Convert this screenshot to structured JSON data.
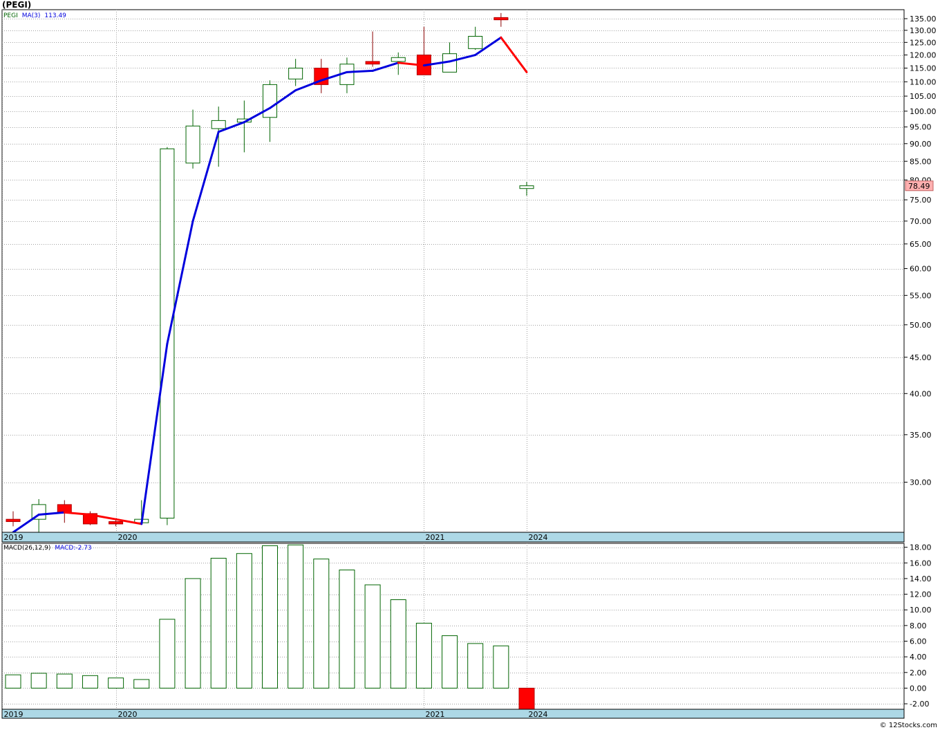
{
  "page": {
    "title": "(PEGI)",
    "credit": "© 12Stocks.com"
  },
  "price_panel": {
    "legend": {
      "symbol": "PEGI",
      "ma_label": "MA(3)",
      "ma_value": "113.49"
    },
    "last_price_label": "78.49",
    "y_ticks": [
      30,
      35,
      40,
      45,
      50,
      55,
      60,
      65,
      70,
      75,
      80,
      85,
      90,
      95,
      100,
      105,
      110,
      115,
      120,
      125,
      130,
      135
    ],
    "x_labels": [
      "2019",
      "2020",
      "2021",
      "2024"
    ]
  },
  "macd_panel": {
    "legend": {
      "label": "MACD(26,12,9)",
      "value_label": "MACD:-2.73"
    },
    "y_ticks": [
      -2,
      0,
      2,
      4,
      6,
      8,
      10,
      12,
      14,
      16,
      18
    ],
    "x_labels": [
      "2019",
      "2020",
      "2021",
      "2024"
    ]
  },
  "colors": {
    "up_candle": "#006400",
    "down_candle": "#ff0000",
    "ma_up": "#0000dd",
    "ma_down": "#ff0000",
    "grid": "#a0a0a0",
    "axis_band": "#add8e6",
    "price_label_bg": "#ffb0b0"
  },
  "chart_data": [
    {
      "type": "candlestick",
      "title": "(PEGI)",
      "scale": "log",
      "ylim": [
        25.5,
        139
      ],
      "x_labels": [
        "2019",
        "2020",
        "2021",
        "2024"
      ],
      "candles": [
        {
          "o": 26.6,
          "h": 27.3,
          "l": 26.0,
          "c": 26.4
        },
        {
          "o": 26.6,
          "h": 28.4,
          "l": 25.5,
          "c": 27.9
        },
        {
          "o": 27.9,
          "h": 28.3,
          "l": 26.3,
          "c": 27.2
        },
        {
          "o": 27.1,
          "h": 27.3,
          "l": 26.1,
          "c": 26.2
        },
        {
          "o": 26.4,
          "h": 26.6,
          "l": 26.0,
          "c": 26.2
        },
        {
          "o": 26.3,
          "h": 28.3,
          "l": 26.2,
          "c": 26.6
        },
        {
          "o": 26.7,
          "h": 89.0,
          "l": 26.1,
          "c": 88.5
        },
        {
          "o": 84.5,
          "h": 100.5,
          "l": 83.0,
          "c": 95.3
        },
        {
          "o": 94.5,
          "h": 101.5,
          "l": 83.5,
          "c": 97.0
        },
        {
          "o": 96.5,
          "h": 103.5,
          "l": 87.5,
          "c": 97.5
        },
        {
          "o": 98.0,
          "h": 110.5,
          "l": 90.5,
          "c": 109.0
        },
        {
          "o": 111.0,
          "h": 118.5,
          "l": 108.5,
          "c": 115.0
        },
        {
          "o": 115.0,
          "h": 118.5,
          "l": 106.0,
          "c": 109.0
        },
        {
          "o": 109.0,
          "h": 119.0,
          "l": 106.0,
          "c": 116.5
        },
        {
          "o": 117.5,
          "h": 129.5,
          "l": 115.5,
          "c": 116.5
        },
        {
          "o": 117.5,
          "h": 121.0,
          "l": 112.5,
          "c": 119.0
        },
        {
          "o": 120.0,
          "h": 131.5,
          "l": 112.5,
          "c": 112.5
        },
        {
          "o": 113.5,
          "h": 125.0,
          "l": 113.5,
          "c": 120.5
        },
        {
          "o": 122.5,
          "h": 131.5,
          "l": 122.0,
          "c": 127.5
        },
        {
          "o": 135.5,
          "h": 137.5,
          "l": 131.5,
          "c": 134.5
        },
        {
          "o": 77.8,
          "h": 79.5,
          "l": 76.0,
          "c": 78.5
        }
      ],
      "ma3": [
        25.5,
        27.0,
        27.2,
        27.0,
        26.6,
        26.2,
        47.0,
        70.0,
        93.5,
        96.5,
        101.0,
        107.0,
        110.5,
        113.5,
        114.0,
        117.0,
        116.0,
        117.5,
        120.0,
        127.0,
        113.5
      ],
      "ma_label": "MA(3)",
      "ma_last": 113.49,
      "last_price": 78.49
    },
    {
      "type": "bar",
      "title": "MACD(26,12,9)",
      "ylim": [
        -2.7,
        18.5
      ],
      "values": [
        1.7,
        1.9,
        1.8,
        1.6,
        1.3,
        1.1,
        8.8,
        14.0,
        16.6,
        17.2,
        18.2,
        18.3,
        16.5,
        15.1,
        13.2,
        11.3,
        8.3,
        6.7,
        5.7,
        5.4,
        -2.73
      ],
      "x_labels": [
        "2019",
        "2020",
        "2021",
        "2024"
      ],
      "last_value": -2.73
    }
  ]
}
